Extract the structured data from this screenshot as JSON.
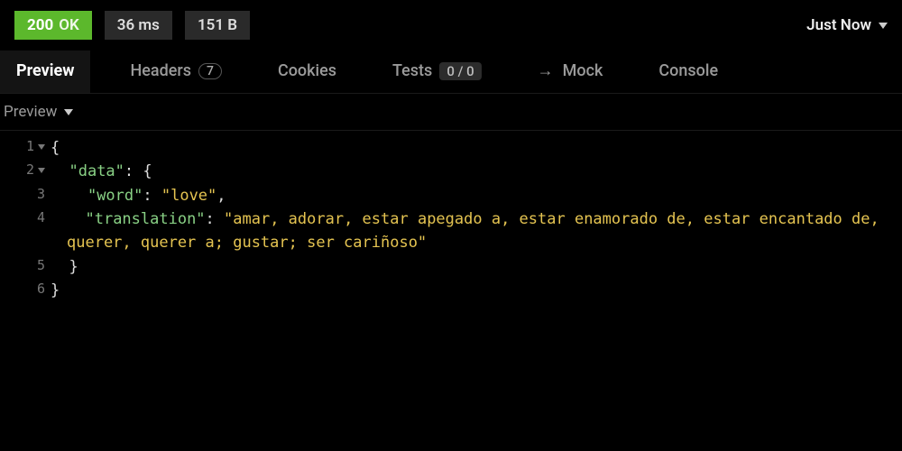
{
  "status": {
    "code": "200",
    "text": "OK"
  },
  "metrics": {
    "time": "36 ms",
    "size": "151 B"
  },
  "timestamp": "Just Now",
  "tabs": {
    "preview": "Preview",
    "headers": {
      "label": "Headers",
      "count": "7"
    },
    "cookies": "Cookies",
    "tests": {
      "label": "Tests",
      "ratio": "0 / 0"
    },
    "mock": "Mock",
    "console": "Console"
  },
  "sub": {
    "label": "Preview"
  },
  "code": {
    "l1": {
      "num": "1",
      "open": "{"
    },
    "l2": {
      "num": "2",
      "key": "\"data\"",
      "colon": ": ",
      "open": "{"
    },
    "l3": {
      "num": "3",
      "key": "\"word\"",
      "colon": ": ",
      "val": "\"love\"",
      "comma": ","
    },
    "l4": {
      "num": "4",
      "key": "\"translation\"",
      "colon": ": ",
      "val": "\"amar, adorar, estar apegado a, estar enamorado de, estar encantado de, querer, querer a; gustar; ser cariñoso\""
    },
    "l5": {
      "num": "5",
      "close": "}"
    },
    "l6": {
      "num": "6",
      "close": "}"
    }
  }
}
